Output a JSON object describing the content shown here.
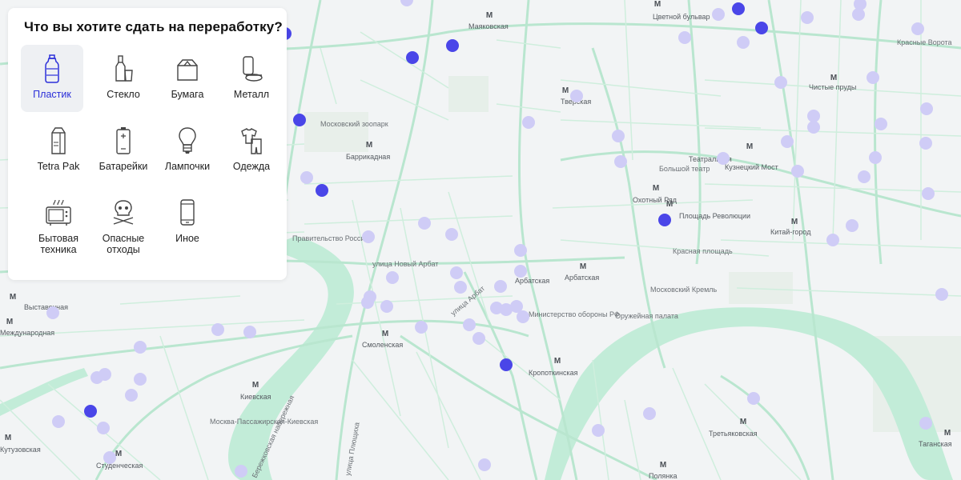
{
  "panel": {
    "title": "Что вы хотите сдать на переработку?",
    "categories": [
      {
        "label": "Пластик",
        "icon": "plastic-bottle-icon",
        "active": true
      },
      {
        "label": "Стекло",
        "icon": "glass-bottle-icon",
        "active": false
      },
      {
        "label": "Бумага",
        "icon": "paper-box-icon",
        "active": false
      },
      {
        "label": "Металл",
        "icon": "metal-can-icon",
        "active": false
      },
      {
        "label": "Tetra Pak",
        "icon": "tetra-pak-icon",
        "active": false
      },
      {
        "label": "Батарейки",
        "icon": "battery-icon",
        "active": false
      },
      {
        "label": "Лампочки",
        "icon": "lightbulb-icon",
        "active": false
      },
      {
        "label": "Одежда",
        "icon": "clothes-icon",
        "active": false
      },
      {
        "label": "Бытовая техника",
        "icon": "microwave-icon",
        "active": false
      },
      {
        "label": "Опасные отходы",
        "icon": "hazard-skull-icon",
        "active": false
      },
      {
        "label": "Иное",
        "icon": "phone-icon",
        "active": false
      }
    ]
  },
  "map": {
    "metro_stations": [
      "Маяковская",
      "Цветной бульвар",
      "Тверская",
      "Чистые пруды",
      "Баррикадная",
      "Театральная",
      "Кузнецкий Мост",
      "Охотный Ряд",
      "Площадь Революции",
      "Китай-город",
      "Арбатская",
      "Арбатская",
      "Выставочная",
      "Смоленская",
      "Кропоткинская",
      "Киевская",
      "Студенческая",
      "Третьяковская",
      "Таганская",
      "Полянка",
      "Кутузовская",
      "Международная"
    ],
    "places": [
      "Московский зоопарк",
      "Правительство России",
      "Большой театр",
      "Красная площадь",
      "Московский Кремль",
      "Министерство обороны РФ",
      "Оружейная палата",
      "Москва-Пассажирская-Киевская",
      "Красные Ворота"
    ],
    "streets": [
      "улица Новый Арбат",
      "улица Арбат",
      "улица Плющиха",
      "Бережковская набережная"
    ],
    "colors": {
      "point_active": "#4a46e8",
      "point_inactive": "#cfccf6",
      "road": "#b9e6cf",
      "river": "#c2ecd8"
    }
  }
}
